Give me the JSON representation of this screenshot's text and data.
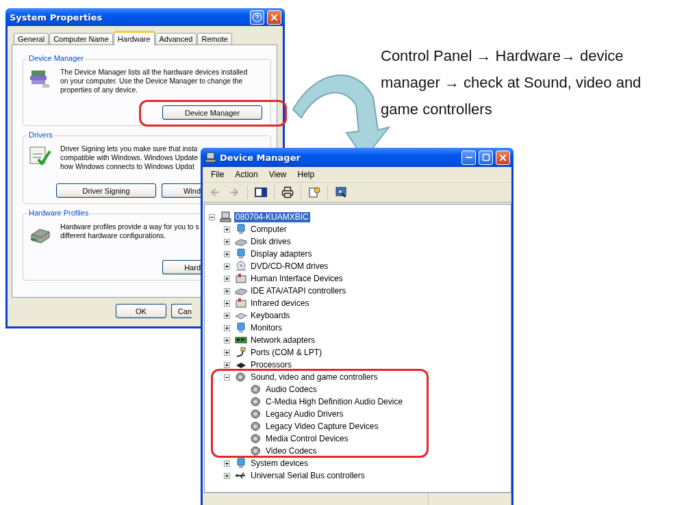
{
  "annotation": {
    "text": "Control Panel → Hardware→ device manager → check at Sound, video and game controllers"
  },
  "system_properties": {
    "title": "System Properties",
    "tabs": [
      {
        "label": "General",
        "selected": false
      },
      {
        "label": "Computer Name",
        "selected": false
      },
      {
        "label": "Hardware",
        "selected": true
      },
      {
        "label": "Advanced",
        "selected": false
      },
      {
        "label": "Remote",
        "selected": false
      }
    ],
    "groups": [
      {
        "title": "Device Manager",
        "text": "The Device Manager lists all the hardware devices installed\non your computer. Use the Device Manager to change the\nproperties of any device.",
        "buttons": [
          "Device Manager"
        ]
      },
      {
        "title": "Drivers",
        "text": "Driver Signing lets you make sure that insta\ncompatible with Windows. Windows Update\nhow Windows connects to Windows Updat",
        "buttons": [
          "Driver Signing",
          "Wind"
        ]
      },
      {
        "title": "Hardware Profiles",
        "text": "Hardware profiles provide a way for you to s\ndifferent hardware configurations.",
        "buttons": [
          "Hard"
        ]
      }
    ],
    "footer_buttons": [
      "OK",
      "Can"
    ]
  },
  "device_manager": {
    "title": "Device Manager",
    "menu": [
      "File",
      "Action",
      "View",
      "Help"
    ],
    "tree": {
      "label": "080704-KUAMXBIC",
      "selected": true,
      "expanded": true,
      "children": [
        {
          "label": "Computer",
          "selected": false,
          "expanded": false
        },
        {
          "label": "Disk drives",
          "selected": false,
          "expanded": false
        },
        {
          "label": "Display adapters",
          "selected": false,
          "expanded": false
        },
        {
          "label": "DVD/CD-ROM drives",
          "selected": false,
          "expanded": false
        },
        {
          "label": "Human Interface Devices",
          "selected": false,
          "expanded": false
        },
        {
          "label": "IDE ATA/ATAPI controllers",
          "selected": false,
          "expanded": false
        },
        {
          "label": "Infrared devices",
          "selected": false,
          "expanded": false
        },
        {
          "label": "Keyboards",
          "selected": false,
          "expanded": false
        },
        {
          "label": "Monitors",
          "selected": false,
          "expanded": false
        },
        {
          "label": "Network adapters",
          "selected": false,
          "expanded": false
        },
        {
          "label": "Ports (COM & LPT)",
          "selected": false,
          "expanded": false
        },
        {
          "label": "Processors",
          "selected": false,
          "expanded": false
        },
        {
          "label": "Sound, video and game controllers",
          "selected": false,
          "expanded": true,
          "children": [
            {
              "label": "Audio Codecs",
              "selected": false
            },
            {
              "label": "C-Media High Definition Audio Device",
              "selected": false
            },
            {
              "label": "Legacy Audio Drivers",
              "selected": false
            },
            {
              "label": "Legacy Video Capture Devices",
              "selected": false
            },
            {
              "label": "Media Control Devices",
              "selected": false
            },
            {
              "label": "Video Codecs",
              "selected": false
            }
          ]
        },
        {
          "label": "System devices",
          "selected": false,
          "expanded": false
        },
        {
          "label": "Universal Serial Bus controllers",
          "selected": false,
          "expanded": false
        }
      ]
    }
  }
}
